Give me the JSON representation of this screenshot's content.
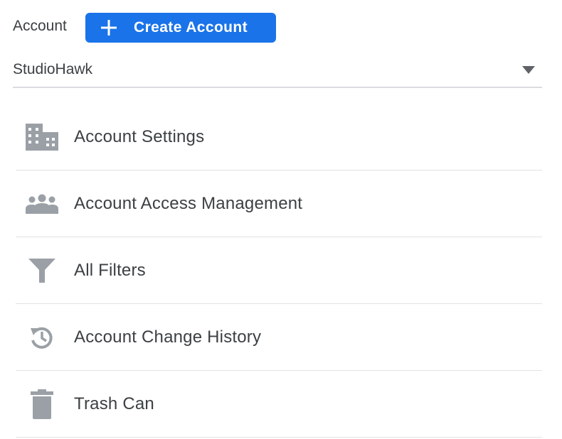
{
  "header": {
    "account_label": "Account",
    "create_button_label": "Create Account",
    "create_button_icon": "plus-icon",
    "accent_color": "#1a73e8"
  },
  "account_selector": {
    "value": "StudioHawk",
    "icon": "dropdown-arrow-icon"
  },
  "menu": {
    "items": [
      {
        "label": "Account Settings",
        "icon": "building-icon"
      },
      {
        "label": "Account Access Management",
        "icon": "people-icon"
      },
      {
        "label": "All Filters",
        "icon": "filter-icon"
      },
      {
        "label": "Account Change History",
        "icon": "history-icon"
      },
      {
        "label": "Trash Can",
        "icon": "trash-icon"
      }
    ]
  }
}
